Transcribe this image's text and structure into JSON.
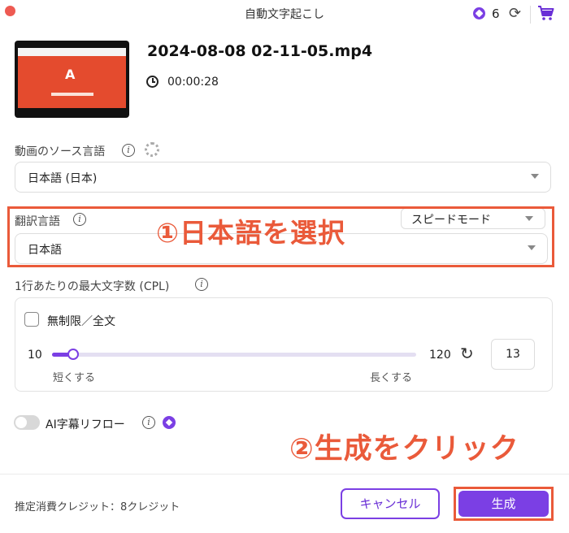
{
  "window": {
    "title": "自動文字起こし"
  },
  "header": {
    "credit_count": "6"
  },
  "media": {
    "filename": "2024-08-08 02-11-05.mp4",
    "duration": "00:00:28"
  },
  "source_language": {
    "label": "動画のソース言語",
    "value": "日本語 (日本)"
  },
  "translation": {
    "label": "翻訳言語",
    "value": "日本語",
    "mode": "スピードモード"
  },
  "annotations": {
    "step1": "①日本語を選択",
    "step2": "②生成をクリック"
  },
  "cpl": {
    "label": "1行あたりの最大文字数 (CPL)",
    "unlimited_label": "無制限／全文",
    "unlimited_checked": false,
    "min": "10",
    "max": "120",
    "value": "13",
    "value_fraction": 0.027,
    "short_label": "短くする",
    "long_label": "長くする"
  },
  "ai_reflow": {
    "label": "AI字幕リフロー",
    "enabled": false
  },
  "footer": {
    "estimated_credits": "推定消費クレジット：8クレジット",
    "cancel_label": "キャンセル",
    "generate_label": "生成"
  },
  "colors": {
    "accent": "#7b3fe4",
    "annotation": "#ea5a3a"
  }
}
